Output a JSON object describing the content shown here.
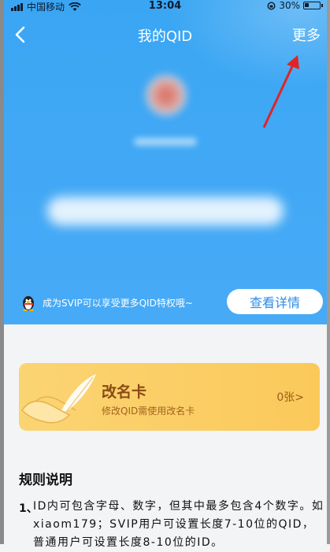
{
  "status_bar": {
    "carrier": "中国移动",
    "time": "13:04",
    "battery": "30%",
    "battery_level": 0.3
  },
  "nav": {
    "title": "我的QID",
    "more_label": "更多"
  },
  "vip_banner": {
    "text": "成为SVIP可以享受更多QID特权哦~",
    "button_label": "查看详情"
  },
  "rename_card": {
    "title": "改名卡",
    "subtitle": "修改QID需使用改名卡",
    "count": "0张>"
  },
  "rules": {
    "title": "规则说明",
    "items": [
      {
        "number": "1、",
        "text": "ID内可包含字母、数字，但其中最多包含4个数字。如xiaom179；SVIP用户可设置长度7-10位的QID，普通用户可设置长度8-10位的ID。"
      }
    ]
  },
  "colors": {
    "hero_blue": "#3aa6f3",
    "card_yellow": "#fbd473",
    "button_text": "#2b8de6",
    "arrow_red": "#e02424"
  }
}
